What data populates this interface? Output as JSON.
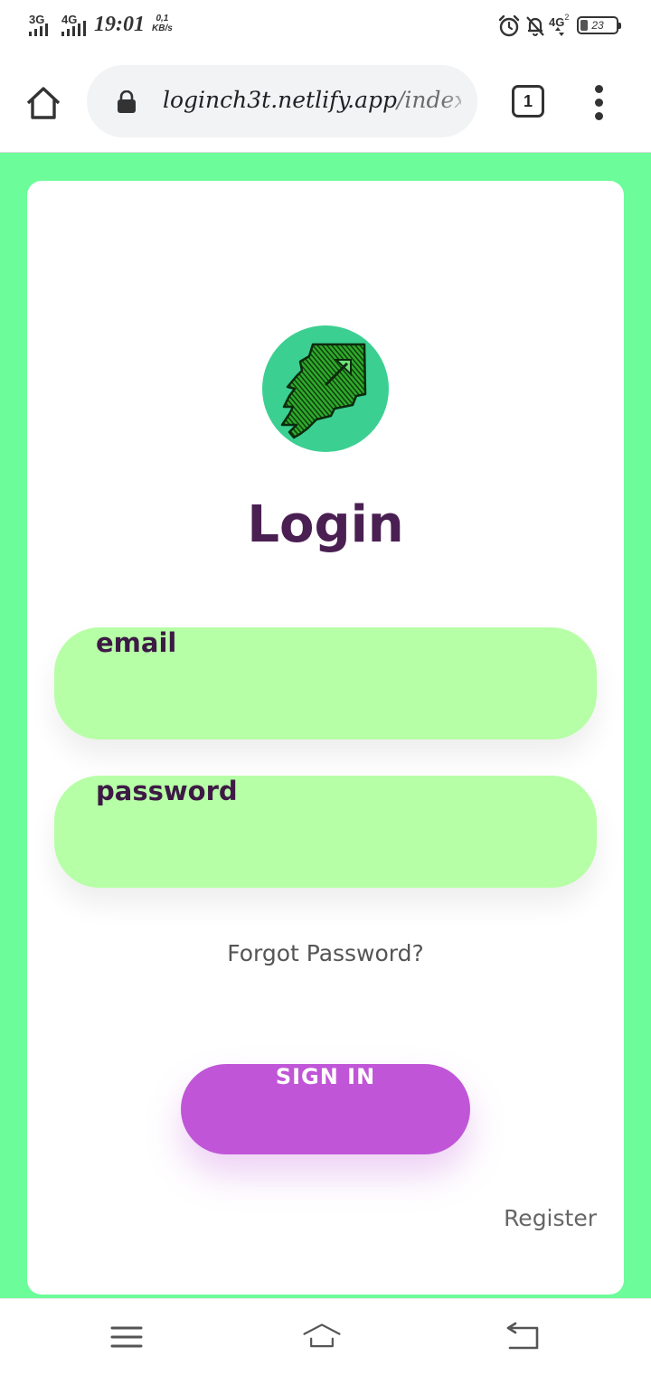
{
  "status_bar": {
    "network_1": "3G",
    "network_2": "4G",
    "time": "19:01",
    "speed_value": "0,1",
    "speed_unit": "KB/s",
    "network_3": "4G",
    "sim_number": "2",
    "battery": "23",
    "icons": [
      "alarm-icon",
      "bell-off-icon",
      "battery-icon"
    ]
  },
  "browser": {
    "url_domain": "loginch3t.netlify.app",
    "url_path": "/index.h",
    "tab_count": "1",
    "icons": [
      "home-icon",
      "lock-icon",
      "more-vert-icon"
    ]
  },
  "page": {
    "background_color": "#6cfc99",
    "title": "Login",
    "email_placeholder": "email",
    "password_placeholder": "password",
    "forgot_password": "Forgot Password?",
    "sign_in": "SIGN IN",
    "register": "Register",
    "accent_color": "#c056d7",
    "input_color": "#b6ffa6",
    "title_color": "#4a1f52"
  },
  "nav": {
    "icons": [
      "menu-icon",
      "home-icon",
      "back-icon"
    ]
  }
}
